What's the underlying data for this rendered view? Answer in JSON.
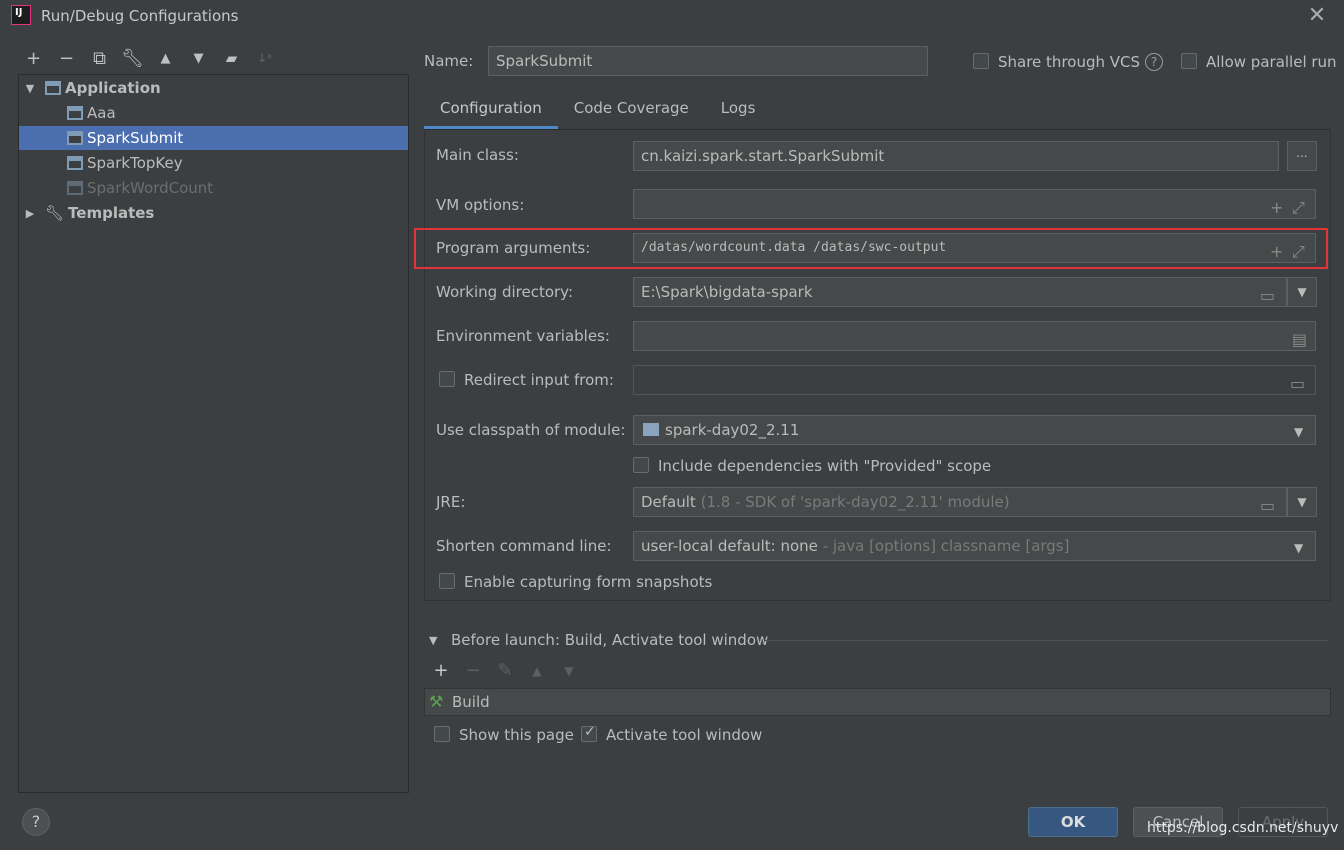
{
  "window": {
    "title": "Run/Debug Configurations"
  },
  "tree": {
    "application": "Application",
    "items": [
      "Aaa",
      "SparkSubmit",
      "SparkTopKey",
      "SparkWordCount"
    ],
    "templates": "Templates"
  },
  "header": {
    "name_label": "Name:",
    "name_value": "SparkSubmit",
    "share_vcs": "Share through VCS",
    "allow_parallel": "Allow parallel run"
  },
  "tabs": [
    "Configuration",
    "Code Coverage",
    "Logs"
  ],
  "form": {
    "main_class_label": "Main class:",
    "main_class_value": "cn.kaizi.spark.start.SparkSubmit",
    "vm_options_label": "VM options:",
    "program_args_label": "Program arguments:",
    "program_args_value": "/datas/wordcount.data /datas/swc-output",
    "working_dir_label": "Working directory:",
    "working_dir_value": "E:\\Spark\\bigdata-spark",
    "env_vars_label": "Environment variables:",
    "redirect_label": "Redirect input from:",
    "classpath_label": "Use classpath of module:",
    "classpath_value": "spark-day02_2.11",
    "include_deps": "Include dependencies with \"Provided\" scope",
    "jre_label": "JRE:",
    "jre_value": "Default",
    "jre_detail": "(1.8 - SDK of 'spark-day02_2.11' module)",
    "shorten_label": "Shorten command line:",
    "shorten_value": "user-local default: none",
    "shorten_detail": "- java [options] classname [args]",
    "capture_label": "Enable capturing form snapshots"
  },
  "before_launch": {
    "title": "Before launch: Build, Activate tool window",
    "build": "Build",
    "show_page": "Show this page",
    "activate": "Activate tool window"
  },
  "buttons": {
    "ok": "OK",
    "cancel": "Cancel",
    "apply": "Apply",
    "help": "?",
    "browse": "..."
  },
  "watermark": "https://blog.csdn.net/shuyv"
}
